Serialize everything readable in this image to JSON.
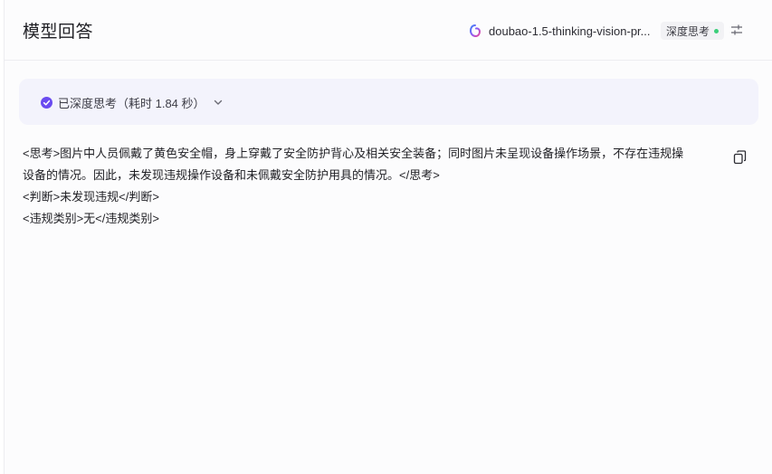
{
  "header": {
    "title": "模型回答",
    "model_name": "doubao-1.5-thinking-vision-pr...",
    "mode_label": "深度思考",
    "model_icon": "doubao-logo-icon",
    "settings_icon": "sliders-icon"
  },
  "thinking": {
    "status_text": "已深度思考（耗时 1.84 秒）",
    "status_icon": "check-circle-icon",
    "toggle_icon": "chevron-down-icon"
  },
  "answer": {
    "lines": [
      "<思考>图片中人员佩戴了黄色安全帽，身上穿戴了安全防护背心及相关安全装备；同时图片未呈现设备操作场景，不存在违规操",
      "设备的情况。因此，未发现违规操作设备和未佩戴安全防护用具的情况。</思考>",
      "<判断>未发现违规</判断>",
      "<违规类别>无</违规类别>"
    ],
    "copy_icon": "copy-icon"
  },
  "colors": {
    "accent": "#6a4bf0",
    "status_dot": "#3ccf7a",
    "thinking_bg": "#f3f3fc"
  }
}
